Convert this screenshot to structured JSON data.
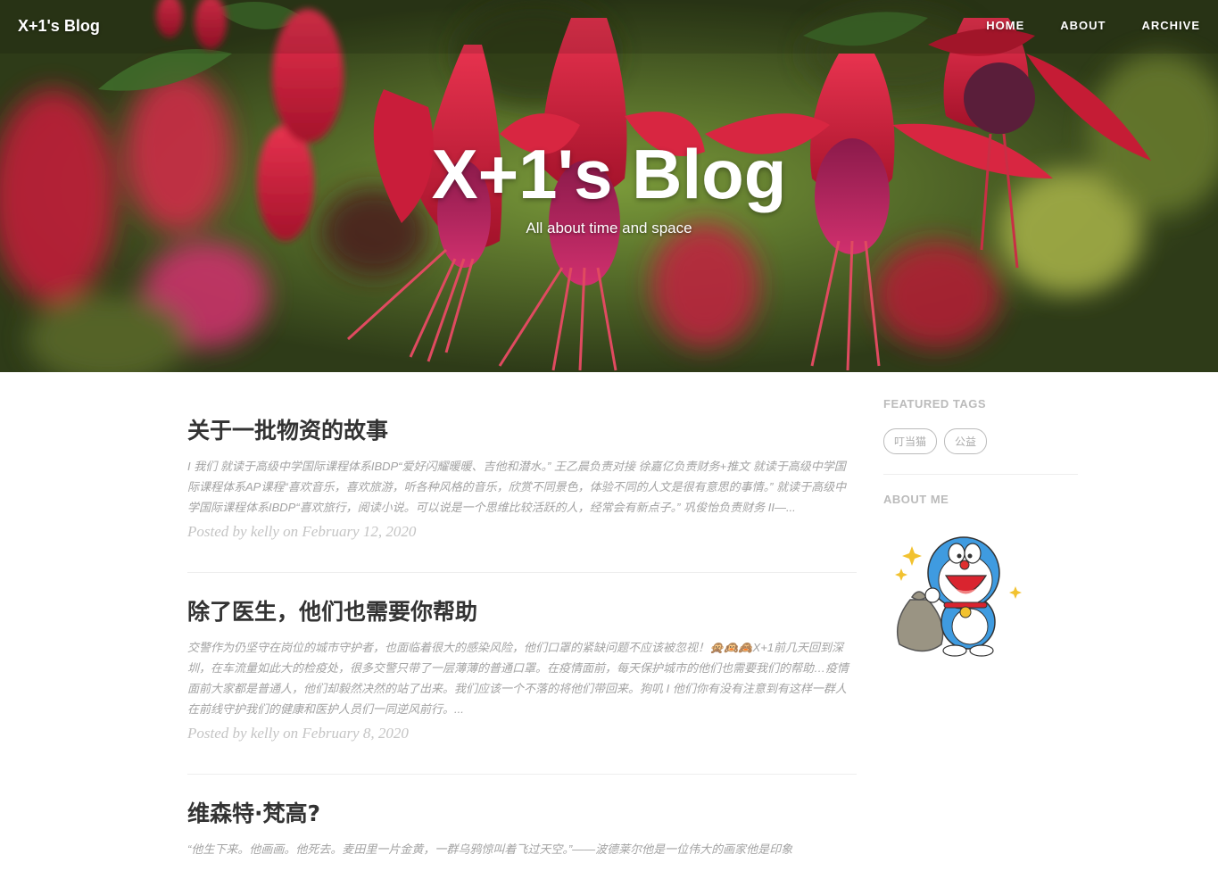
{
  "header": {
    "brand": "X+1's Blog",
    "nav": [
      "HOME",
      "ABOUT",
      "ARCHIVE"
    ],
    "title": "X+1's Blog",
    "subtitle": "All about time and space"
  },
  "posts": [
    {
      "title": "关于一批物资的故事",
      "excerpt": "I 我们 就读于高级中学国际课程体系IBDP“爱好闪耀暖暖、吉他和潜水。” 王乙晨负责对接 徐嘉亿负责财务+推文 就读于高级中学国际课程体系AP课程“喜欢音乐，喜欢旅游，听各种风格的音乐，欣赏不同景色，体验不同的人文是很有意思的事情。” 就读于高级中学国际课程体系IBDP“喜欢旅行，阅读小说。可以说是一个思维比较活跃的人，经常会有新点子。” 巩俊怡负责财务 II—...",
      "meta": "Posted by kelly on February 12, 2020"
    },
    {
      "title": "除了医生，他们也需要你帮助",
      "excerpt": "交警作为仍坚守在岗位的城市守护者，也面临着很大的感染风险，他们口罩的紧缺问题不应该被忽视！🙊🙉🙈X+1前几天回到深圳，在车流量如此大的检疫处，很多交警只带了一层薄薄的普通口罩。在疫情面前，每天保护城市的他们也需要我们的帮助…疫情面前大家都是普通人，他们却毅然决然的站了出来。我们应该一个不落的将他们带回来。狗叽 I 他们你有没有注意到有这样一群人在前线守护我们的健康和医护人员们一同逆风前行。...",
      "meta": "Posted by kelly on February 8, 2020"
    },
    {
      "title": "维森特·梵高?",
      "excerpt": "“他生下来。他画画。他死去。麦田里一片金黄，一群乌鸦惊叫着飞过天空。”——波德莱尔他是一位伟大的画家他是印象",
      "meta": ""
    }
  ],
  "sidebar": {
    "featured_tags_heading": "FEATURED TAGS",
    "tags": [
      "叮当猫",
      "公益"
    ],
    "about_heading": "ABOUT ME",
    "avatar_icon": "doraemon-with-money-bag"
  },
  "colors": {
    "accent_flower": "#d0213c",
    "text_dark": "#333333",
    "text_muted": "#a3a3a3"
  }
}
